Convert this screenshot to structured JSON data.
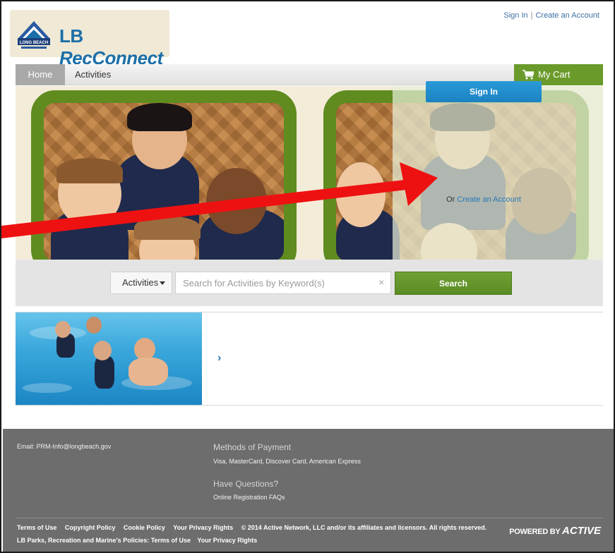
{
  "header": {
    "logo_text_part1": "LB ",
    "logo_text_part2": "RecConnect",
    "seal_text": "LONG BEACH",
    "top_links": {
      "sign_in": "Sign In",
      "separator": "|",
      "create_account": "Create an Account"
    }
  },
  "nav": {
    "tabs": [
      {
        "label": "Home"
      },
      {
        "label": "Activities"
      }
    ],
    "cart_label": "My Cart"
  },
  "hero": {
    "signin_button": "Sign In",
    "or_text": "Or ",
    "create_account_link": "Create an Account"
  },
  "search": {
    "category_label": "Activities",
    "placeholder": "Search for Activities by Keyword(s)",
    "clear_glyph": "×",
    "button_label": "Search"
  },
  "banner": {
    "next_glyph": "›"
  },
  "footer": {
    "email": "Email: PRM-Info@longbeach.gov",
    "payment_heading": "Methods of Payment",
    "payment_text": "Visa, MasterCard, Discover Card, American Express",
    "questions_heading": "Have Questions?",
    "questions_link": "Online Registration FAQs",
    "links_row1": [
      "Terms of Use",
      "Copyright Policy",
      "Cookie Policy",
      "Your Privacy Rights",
      "© 2014 Active Network, LLC and/or its affiliates and licensors. All rights reserved."
    ],
    "links_row2": [
      "LB Parks, Recreation and Marine's Policies: Terms of Use",
      "Your Privacy Rights"
    ],
    "powered_prefix": "POWERED BY ",
    "powered_brand": "ACTIVE"
  },
  "colors": {
    "nav_green": "#6a9a2a",
    "button_blue": "#1c82c2",
    "link_blue": "#2a78b8",
    "footer_gray": "#6d6d6d",
    "annotation_arrow": "#ee1111"
  },
  "icons": [
    "cart-icon",
    "close-icon",
    "chevron-right-icon",
    "caret-down-icon",
    "seal-logo"
  ]
}
